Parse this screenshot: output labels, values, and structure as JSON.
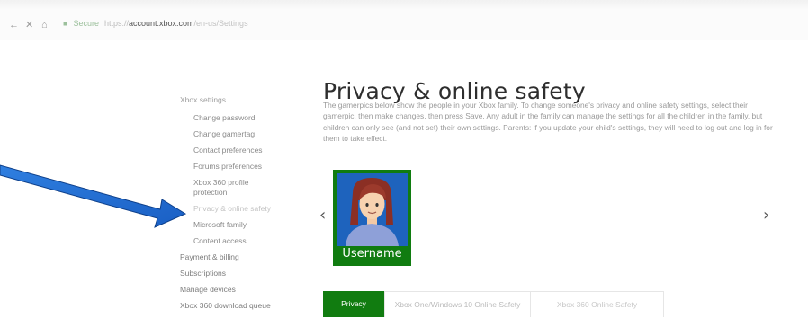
{
  "browser": {
    "back": "←",
    "close": "✕",
    "home": "⌂",
    "secure_label": "Secure",
    "url_protocol": "https://",
    "url_host": "account.xbox.com",
    "url_path": "/en-us/Settings"
  },
  "sidebar": {
    "heading": "Xbox settings",
    "subitems": [
      "Change password",
      "Change gamertag",
      "Contact preferences",
      "Forums preferences",
      "Xbox 360 profile protection",
      "Privacy & online safety",
      "Microsoft family",
      "Content access"
    ],
    "items": [
      "Payment & billing",
      "Subscriptions",
      "Manage devices",
      "Xbox 360 download queue"
    ]
  },
  "main": {
    "title": "Privacy & online safety",
    "description": "The gamerpics below show the people in your Xbox family. To change someone's privacy and online safety settings, select their gamerpic, then make changes, then press Save. Any adult in the family can manage the settings for all the children in the family, but children can only see (and not set) their own settings. Parents: if you update your child's settings, they will need to log out and log in for them to take effect.",
    "carousel_prev": "‹",
    "carousel_next": "›",
    "member": {
      "name": "Username"
    }
  },
  "tabs": [
    {
      "label": "Privacy"
    },
    {
      "label": "Xbox One/Windows 10 Online Safety"
    },
    {
      "label": "Xbox 360 Online Safety"
    }
  ],
  "colors": {
    "xbox_green": "#107c10",
    "avatar_blue": "#1e63bd",
    "annotation_arrow": "#1f6fd6"
  }
}
